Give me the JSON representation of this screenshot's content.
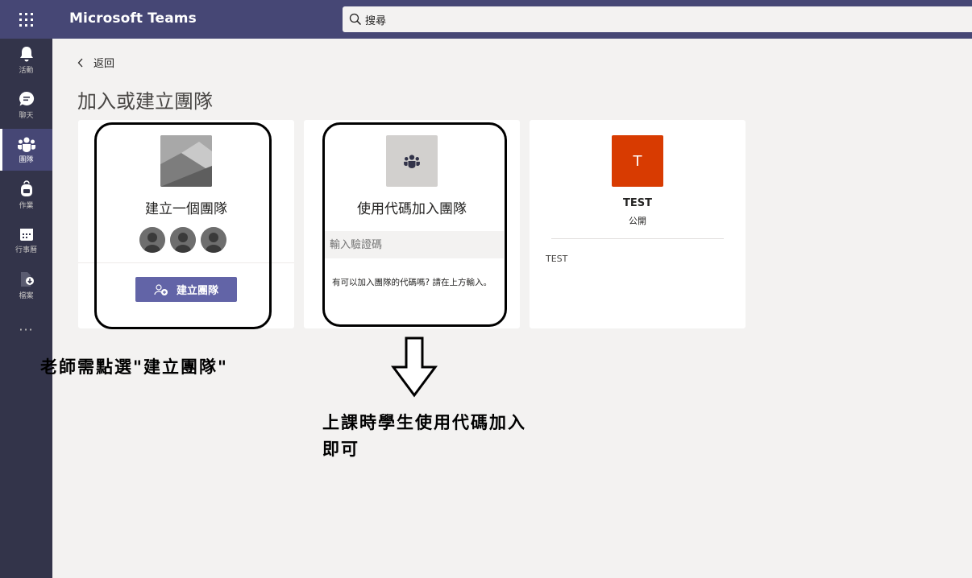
{
  "app": {
    "title": "Microsoft Teams"
  },
  "search": {
    "placeholder": "搜尋"
  },
  "rail": {
    "items": [
      {
        "label": "活動",
        "icon": "bell-icon"
      },
      {
        "label": "聊天",
        "icon": "chat-icon"
      },
      {
        "label": "團隊",
        "icon": "teams-icon",
        "active": true
      },
      {
        "label": "作業",
        "icon": "backpack-icon"
      },
      {
        "label": "行事曆",
        "icon": "calendar-icon"
      },
      {
        "label": "檔案",
        "icon": "file-icon"
      }
    ],
    "more": "···"
  },
  "nav": {
    "back_label": "返回"
  },
  "page": {
    "title": "加入或建立團隊"
  },
  "create_card": {
    "title": "建立一個團隊",
    "button_label": "建立團隊"
  },
  "join_card": {
    "title": "使用代碼加入團隊",
    "input_placeholder": "輸入驗證碼",
    "hint": "有可以加入團隊的代碼嗎? 請在上方輸入。"
  },
  "team_card": {
    "initial": "T",
    "name": "TEST",
    "visibility": "公開",
    "description": "TEST",
    "color": "#d83b01"
  },
  "annotations": {
    "teacher_note": "老師需點選\"建立團隊\"",
    "student_note_line1": "上課時學生使用代碼加入",
    "student_note_line2": "即可"
  },
  "colors": {
    "brand": "#464775",
    "rail": "#33344a",
    "accent": "#6264a7"
  }
}
